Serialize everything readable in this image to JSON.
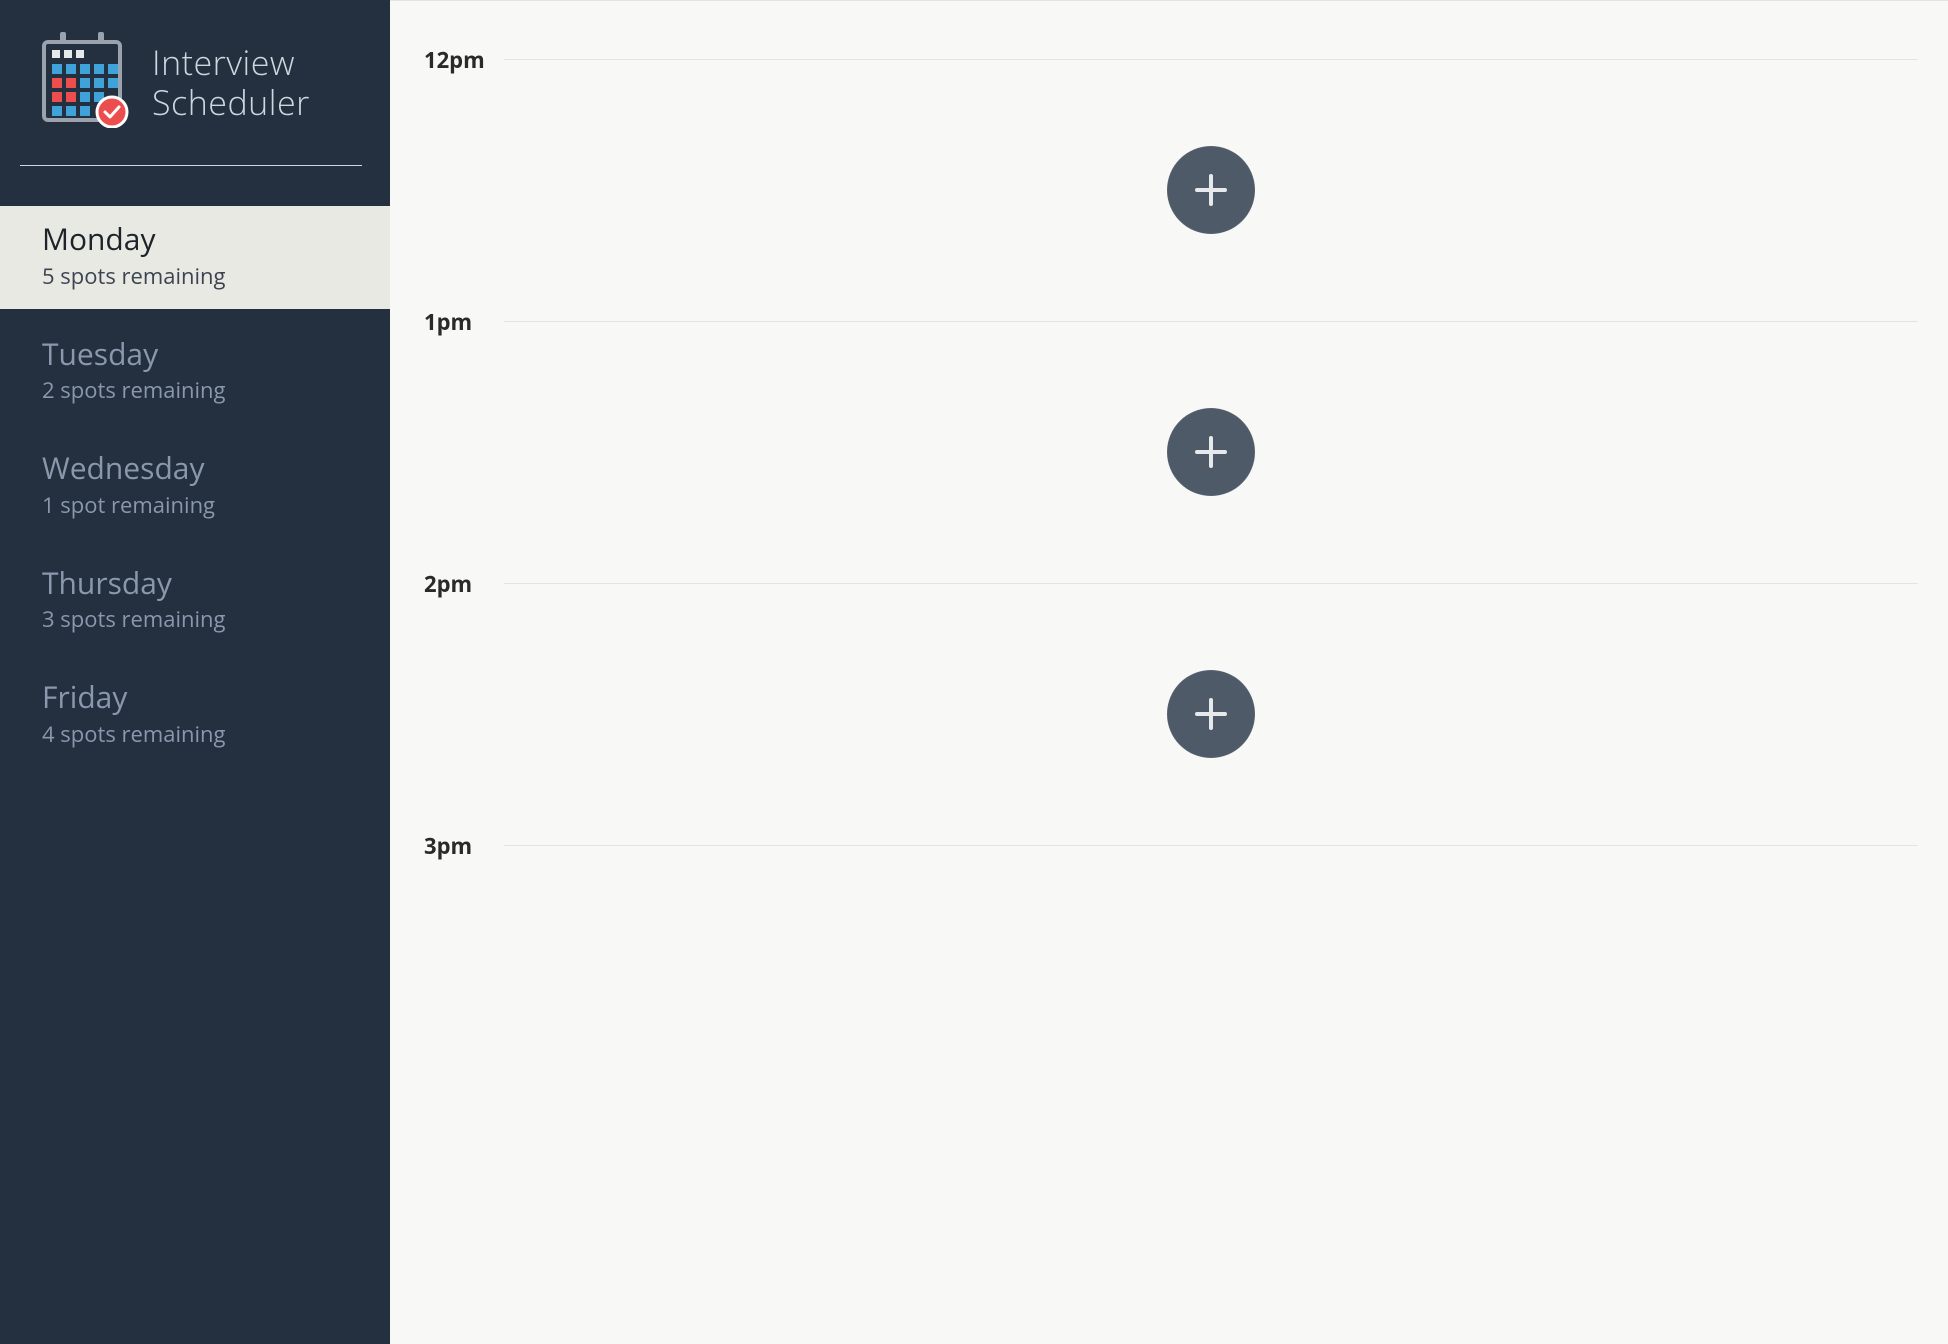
{
  "app": {
    "title_line1": "Interview",
    "title_line2": "Scheduler"
  },
  "colors": {
    "sidebar_bg": "#222f3e",
    "accent_red": "#ec4d4d",
    "accent_blue": "#3fa2d9",
    "add_btn_bg": "#4f5a68",
    "selected_bg": "#e9e9e4"
  },
  "sidebar": {
    "days": [
      {
        "name": "Monday",
        "spots": "5 spots remaining",
        "selected": true
      },
      {
        "name": "Tuesday",
        "spots": "2 spots remaining",
        "selected": false
      },
      {
        "name": "Wednesday",
        "spots": "1 spot remaining",
        "selected": false
      },
      {
        "name": "Thursday",
        "spots": "3 spots remaining",
        "selected": false
      },
      {
        "name": "Friday",
        "spots": "4 spots remaining",
        "selected": false
      }
    ]
  },
  "schedule": {
    "time_slots": [
      {
        "label": "12pm",
        "has_add": true
      },
      {
        "label": "1pm",
        "has_add": true
      },
      {
        "label": "2pm",
        "has_add": true
      },
      {
        "label": "3pm",
        "has_add": false
      }
    ]
  },
  "icons": {
    "logo": "calendar-check-icon",
    "add": "plus-icon"
  }
}
